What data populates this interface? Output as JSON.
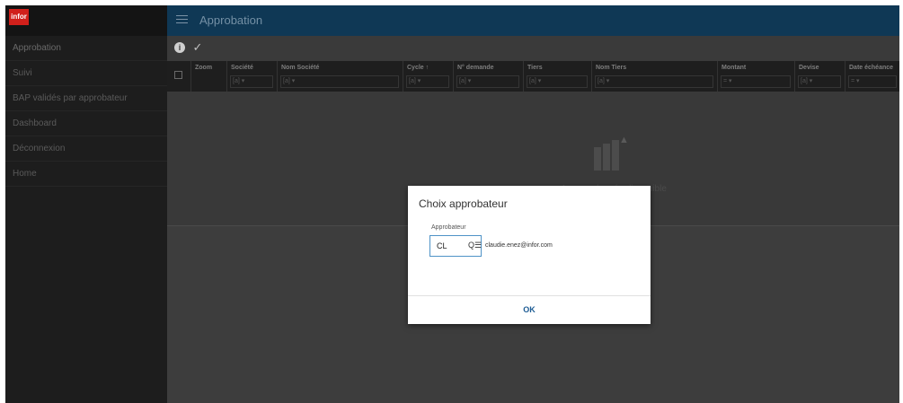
{
  "app": {
    "logo_text": "infor",
    "title": "Approbation"
  },
  "sidebar": {
    "items": [
      {
        "label": "Approbation"
      },
      {
        "label": "Suivi"
      },
      {
        "label": "BAP validés par approbateur"
      },
      {
        "label": "Dashboard"
      },
      {
        "label": "Déconnexion"
      },
      {
        "label": "Home"
      }
    ]
  },
  "toolbar": {
    "info_icon": "info-icon",
    "check_icon": "check-icon"
  },
  "grid": {
    "columns": [
      {
        "label": "Zoom",
        "filter": ""
      },
      {
        "label": "Société",
        "filter": "[a] ▾"
      },
      {
        "label": "Nom Société",
        "filter": "[a] ▾"
      },
      {
        "label": "Cycle ↑",
        "filter": "[a] ▾"
      },
      {
        "label": "N° demande",
        "filter": "[a] ▾"
      },
      {
        "label": "Tiers",
        "filter": "[a] ▾"
      },
      {
        "label": "Nom Tiers",
        "filter": "[a] ▾"
      },
      {
        "label": "Montant",
        "filter": "= ▾"
      },
      {
        "label": "Devise",
        "filter": "[a] ▾"
      },
      {
        "label": "Date échéance",
        "filter": "= ▾"
      }
    ],
    "empty_text": "Aucune donnée disponible"
  },
  "modal": {
    "title": "Choix approbateur",
    "field_label": "Approbateur",
    "field_value": "CL",
    "field_description": "claudie.enez@infor.com",
    "ok_label": "OK"
  },
  "colors": {
    "header": "#0f3855",
    "logo": "#d1201b",
    "ok_button": "#1d5c94"
  }
}
